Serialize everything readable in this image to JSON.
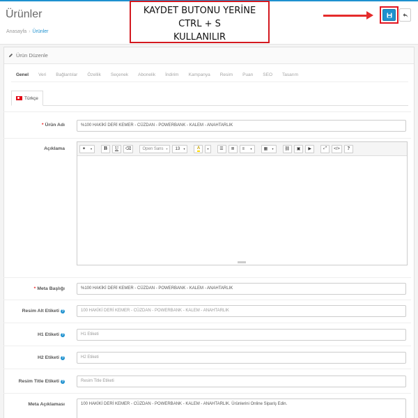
{
  "header": {
    "title": "Ürünler",
    "breadcrumb": [
      "Anasayfa",
      "Ürünler"
    ]
  },
  "annotation": {
    "lines": [
      "KAYDET BUTONU YERİNE",
      "CTRL + S",
      "KULLANILIR"
    ],
    "color": "#d3181f"
  },
  "buttons": {
    "save_icon": "save-icon",
    "back_icon": "reply-icon",
    "primary_color": "#1e91cf"
  },
  "panel": {
    "heading": "Ürün Düzenle"
  },
  "tabs": [
    "Genel",
    "Veri",
    "Bağlantılar",
    "Özellik",
    "Seçenek",
    "Abonelik",
    "İndirim",
    "Kampanya",
    "Resim",
    "Puan",
    "SEO",
    "Tasarım"
  ],
  "language_tab": "Türkçe",
  "editor": {
    "font_name": "Open Sans",
    "font_size": "13"
  },
  "fields": {
    "product_name": {
      "label": "Ürün Adı",
      "value": "%100 HAKİKİ DERİ KEMER - CÜZDAN - POWERBANK - KALEM - ANAHTARLIK"
    },
    "description": {
      "label": "Açıklama"
    },
    "meta_title": {
      "label": "Meta Başlığı",
      "value": "%100 HAKİKİ DERİ KEMER - CÜZDAN - POWERBANK - KALEM - ANAHTARLIK"
    },
    "image_alt": {
      "label": "Resim Alt Etiketi",
      "placeholder": "100 HAKİKİ DERİ KEMER - CÜZDAN - POWERBANK - KALEM - ANAHTARLIK"
    },
    "h1": {
      "label": "H1 Etiketi",
      "placeholder": "H1 Etiketi"
    },
    "h2": {
      "label": "H2 Etiketi",
      "placeholder": "H2 Etiketi"
    },
    "image_title": {
      "label": "Resim Title Etiketi",
      "placeholder": "Resim Title Etiketi"
    },
    "meta_desc": {
      "label": "Meta Açıklaması",
      "value": "100 HAKİKİ DERİ KEMER - CÜZDAN - POWERBANK - KALEM - ANAHTARLIK. Ürünlerini Online Sipariş Edin."
    }
  }
}
